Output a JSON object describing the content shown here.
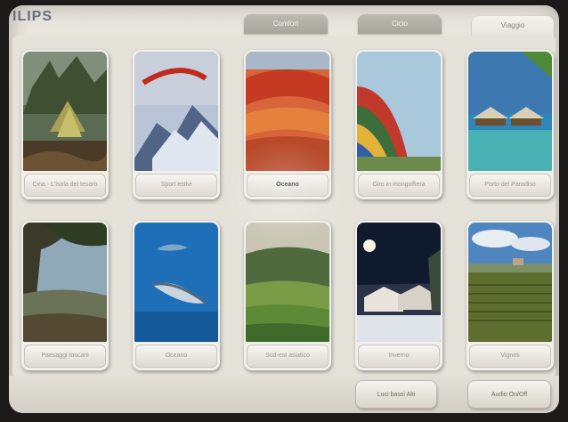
{
  "brand": "ILIPS",
  "tabs": [
    {
      "label": "Comfort"
    },
    {
      "label": "Ciclo"
    },
    {
      "label": "Viaggio"
    }
  ],
  "programs": [
    {
      "label": "Cina - L'isola del tesoro"
    },
    {
      "label": "Sport estivi"
    },
    {
      "label": "Oceano"
    },
    {
      "label": "Giro in mongolfiera"
    },
    {
      "label": "Porto del Paradiso"
    },
    {
      "label": "Paesaggi toscani"
    },
    {
      "label": "Oceano"
    },
    {
      "label": "Sud-est asiatico"
    },
    {
      "label": "Inverno"
    },
    {
      "label": "Vigneti"
    }
  ],
  "bottom": {
    "lights_label": "Luci bassi Alti",
    "audio_label": "Audio On/Off"
  },
  "colors": {
    "screen_bg": "#e6e3db",
    "active_tab": "#f1efe9",
    "inactive_tab": "#b1ada4"
  }
}
